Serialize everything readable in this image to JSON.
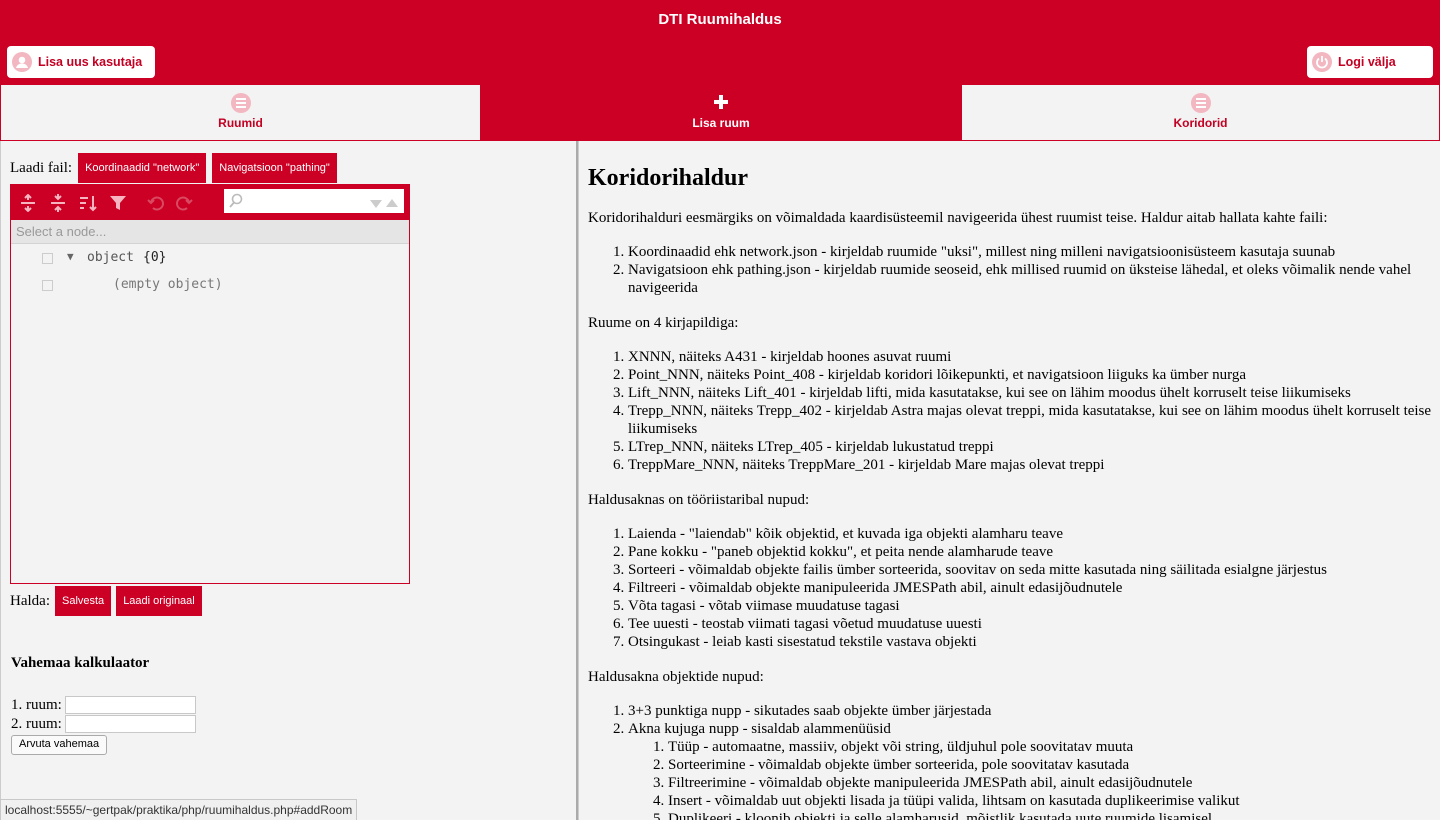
{
  "header": {
    "title": "DTI Ruumihaldus",
    "add_user_label": "Lisa uus kasutaja",
    "logout_label": "Logi välja"
  },
  "tabs": [
    {
      "label": "Ruumid",
      "icon": "menu-icon"
    },
    {
      "label": "Lisa ruum",
      "icon": "plus-icon",
      "active": true
    },
    {
      "label": "Koridorid",
      "icon": "menu-icon"
    }
  ],
  "left": {
    "load_label": "Laadi fail:",
    "btn_network": "Koordinaadid \"network\"",
    "btn_pathing": "Navigatsioon \"pathing\"",
    "editor": {
      "nav_placeholder": "Select a node...",
      "root_label": "object",
      "root_count": "{0}",
      "empty_label": "(empty object)"
    },
    "halda_label": "Halda:",
    "btn_save": "Salvesta",
    "btn_load_original": "Laadi originaal",
    "calc_title": "Vahemaa kalkulaator",
    "room1_label": "1. ruum:",
    "room2_label": "2. ruum:",
    "calc_button": "Arvuta vahemaa"
  },
  "status_url": "localhost:5555/~gertpak/praktika/php/ruumihaldus.php#addRoom",
  "doc": {
    "title": "Koridorihaldur",
    "intro": "Koridorihalduri eesmärgiks on võimaldada kaardisüsteemil navigeerida ühest ruumist teise. Haldur aitab hallata kahte faili:",
    "files": [
      "Koordinaadid ehk network.json - kirjeldab ruumide \"uksi\", millest ning milleni navigatsioonisüsteem kasutaja suunab",
      "Navigatsioon ehk pathing.json - kirjeldab ruumide seoseid, ehk millised ruumid on üksteise lähedal, et oleks võimalik nende vahel navigeerida"
    ],
    "rooms_intro": "Ruume on 4 kirjapildiga:",
    "rooms": [
      "XNNN, näiteks A431 - kirjeldab hoones asuvat ruumi",
      "Point_NNN, näiteks Point_408 - kirjeldab koridori lõikepunkti, et navigatsioon liiguks ka ümber nurga",
      "Lift_NNN, näiteks Lift_401 - kirjeldab lifti, mida kasutatakse, kui see on lähim moodus ühelt korruselt teise liikumiseks",
      "Trepp_NNN, näiteks Trepp_402 - kirjeldab Astra majas olevat treppi, mida kasutatakse, kui see on lähim moodus ühelt korruselt teise liikumiseks",
      "LTrep_NNN, näiteks LTrep_405 - kirjeldab lukustatud treppi",
      "TreppMare_NNN, näiteks TreppMare_201 - kirjeldab Mare majas olevat treppi"
    ],
    "toolbar_intro": "Haldusaknas on tööriistaribal nupud:",
    "toolbar": [
      "Laienda - \"laiendab\" kõik objektid, et kuvada iga objekti alamharu teave",
      "Pane kokku - \"paneb objektid kokku\", et peita nende alamharude teave",
      "Sorteeri - võimaldab objekte failis ümber sorteerida, soovitav on seda mitte kasutada ning säilitada esialgne järjestus",
      "Filtreeri - võimaldab objekte manipuleerida JMESPath abil, ainult edasijõudnutele",
      "Võta tagasi - võtab viimase muudatuse tagasi",
      "Tee uuesti - teostab viimati tagasi võetud muudatuse uuesti",
      "Otsingukast - leiab kasti sisestatud tekstile vastava objekti"
    ],
    "objects_intro": "Haldusakna objektide nupud:",
    "objects": [
      "3+3 punktiga nupp - sikutades saab objekte ümber järjestada",
      "Akna kujuga nupp - sisaldab alammenüüsid"
    ],
    "submenu": [
      "Tüüp - automaatne, massiiv, objekt või string, üldjuhul pole soovitatav muuta",
      "Sorteerimine - võimaldab objekte ümber sorteerida, pole soovitatav kasutada",
      "Filtreerimine - võimaldab objekte manipuleerida JMESPath abil, ainult edasijõudnutele",
      "Insert - võimaldab uut objekti lisada ja tüüpi valida, lihtsam on kasutada duplikeerimise valikut",
      "Duplikeeri - kloonib objekti ja selle alamharusid, mõistlik kasutada uute ruumide lisamisel"
    ]
  }
}
